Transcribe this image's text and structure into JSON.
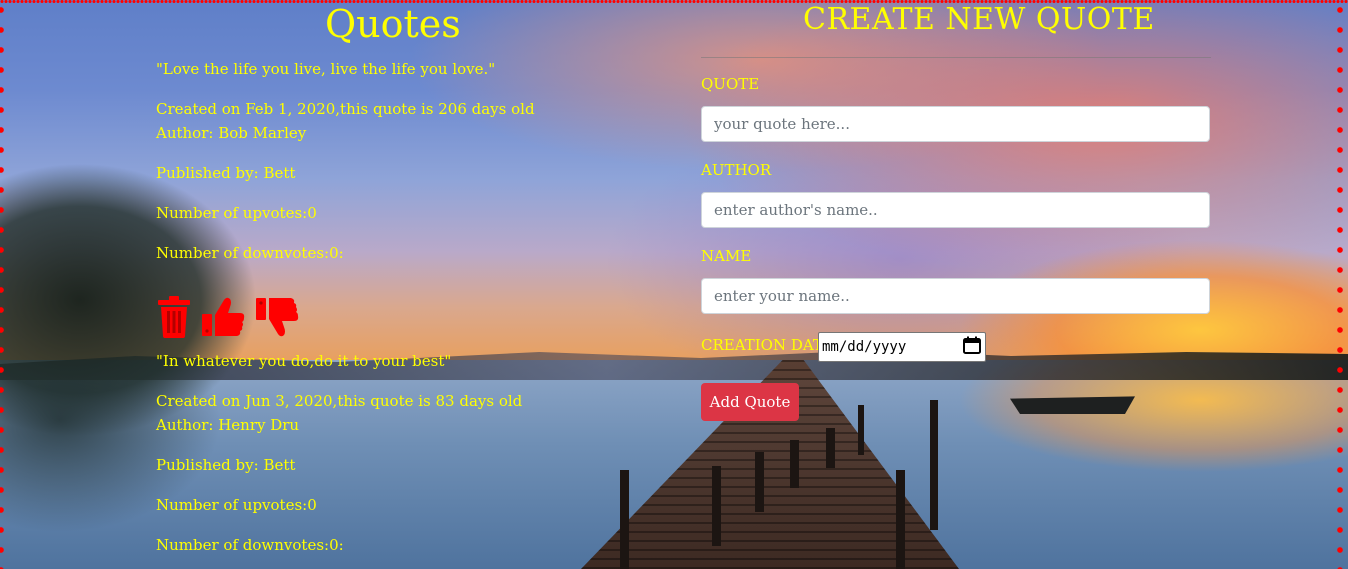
{
  "quotes_section": {
    "title": "Quotes",
    "quotes": [
      {
        "text": "\"Love the life you live, live the life you love.\"",
        "created": "Created on Feb 1, 2020,this quote is 206 days old",
        "author": "Author: Bob Marley",
        "published": "Published by: Bett",
        "upvotes": "Number of upvotes:0",
        "downvotes": "Number of downvotes:0:"
      },
      {
        "text": "\"In whatever you do,do it to your best\"",
        "created": "Created on Jun 3, 2020,this quote is 83 days old",
        "author": "Author: Henry Dru",
        "published": "Published by: Bett",
        "upvotes": "Number of upvotes:0",
        "downvotes": "Number of downvotes:0:"
      }
    ],
    "icons": [
      "trash-icon",
      "thumbs-up-icon",
      "thumbs-down-icon"
    ],
    "icon_color": "#ff0000"
  },
  "form": {
    "title": "CREATE NEW QUOTE",
    "quote_label": "QUOTE",
    "quote_placeholder": "your quote here...",
    "author_label": "AUTHOR",
    "author_placeholder": "enter author's name..",
    "name_label": "NAME",
    "name_placeholder": "enter your name..",
    "date_label": "CREATION DATE",
    "date_placeholder": "mm/dd/yyyy",
    "submit_label": "Add Quote"
  },
  "colors": {
    "text": "#ffff00",
    "button": "#dc3545",
    "border_dots": "#ff0000"
  }
}
